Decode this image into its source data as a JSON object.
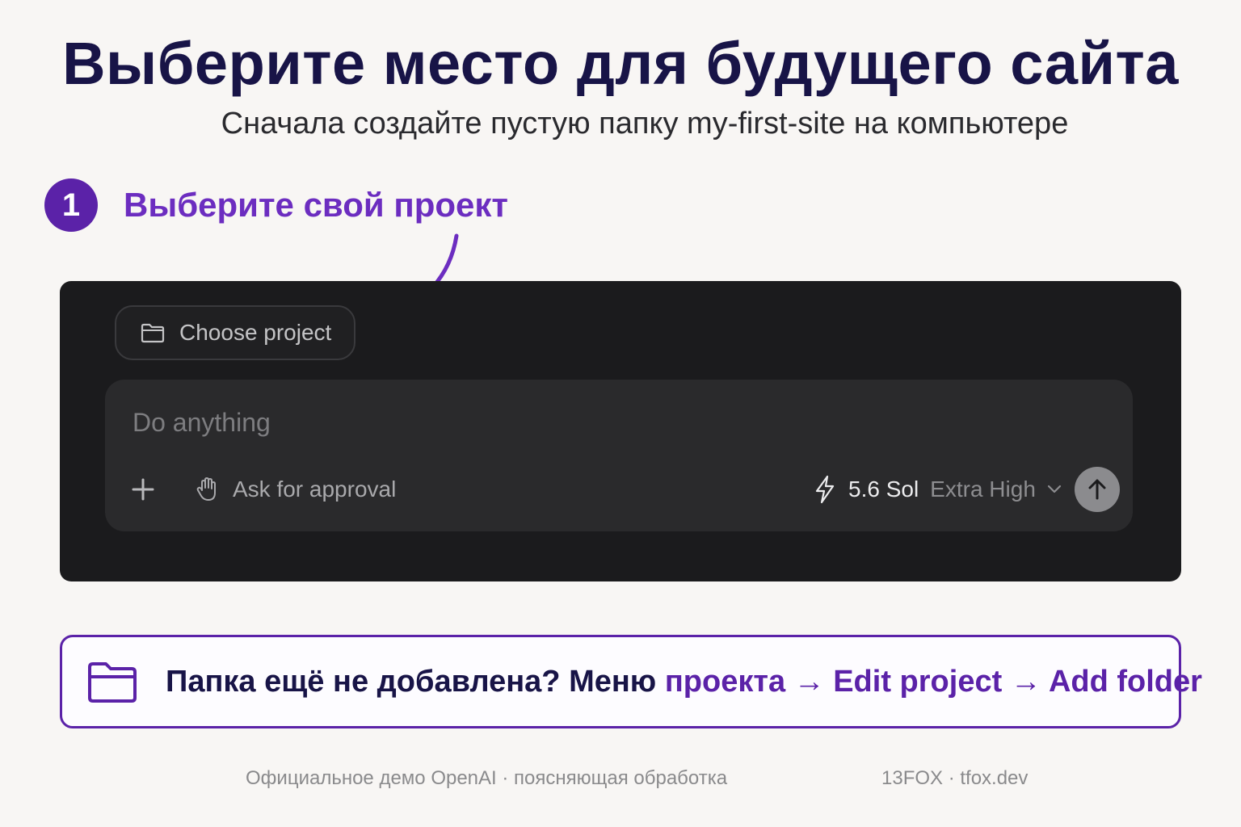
{
  "header": {
    "title": "Выберите место для будущего сайта",
    "subtitle": "Сначала создайте пустую папку my-first-site на компьютере"
  },
  "step": {
    "number": "1",
    "label": "Выберите свой проект"
  },
  "app": {
    "choose_project_label": "Choose project",
    "composer_placeholder": "Do anything",
    "approval_label": "Ask for approval",
    "model_name": "5.6 Sol",
    "reasoning_effort": "Extra High",
    "icons": {
      "choose_project": "folder-icon",
      "add": "plus-icon",
      "approval": "hand-icon",
      "model": "bolt-icon",
      "dropdown": "chevron-down-icon",
      "send": "arrow-up-icon"
    }
  },
  "note": {
    "icon": "folder-icon",
    "prefix": "Папка ещё не добавлена? Меню ",
    "path": "проекта → Edit project → Add folder"
  },
  "footer": {
    "left": "Официальное демо OpenAI · поясняющая обработка",
    "right": "13FOX · tfox.dev"
  },
  "colors": {
    "accent": "#5b22a8",
    "title": "#181447",
    "panel": "#1b1b1d",
    "background": "#f8f6f4"
  }
}
